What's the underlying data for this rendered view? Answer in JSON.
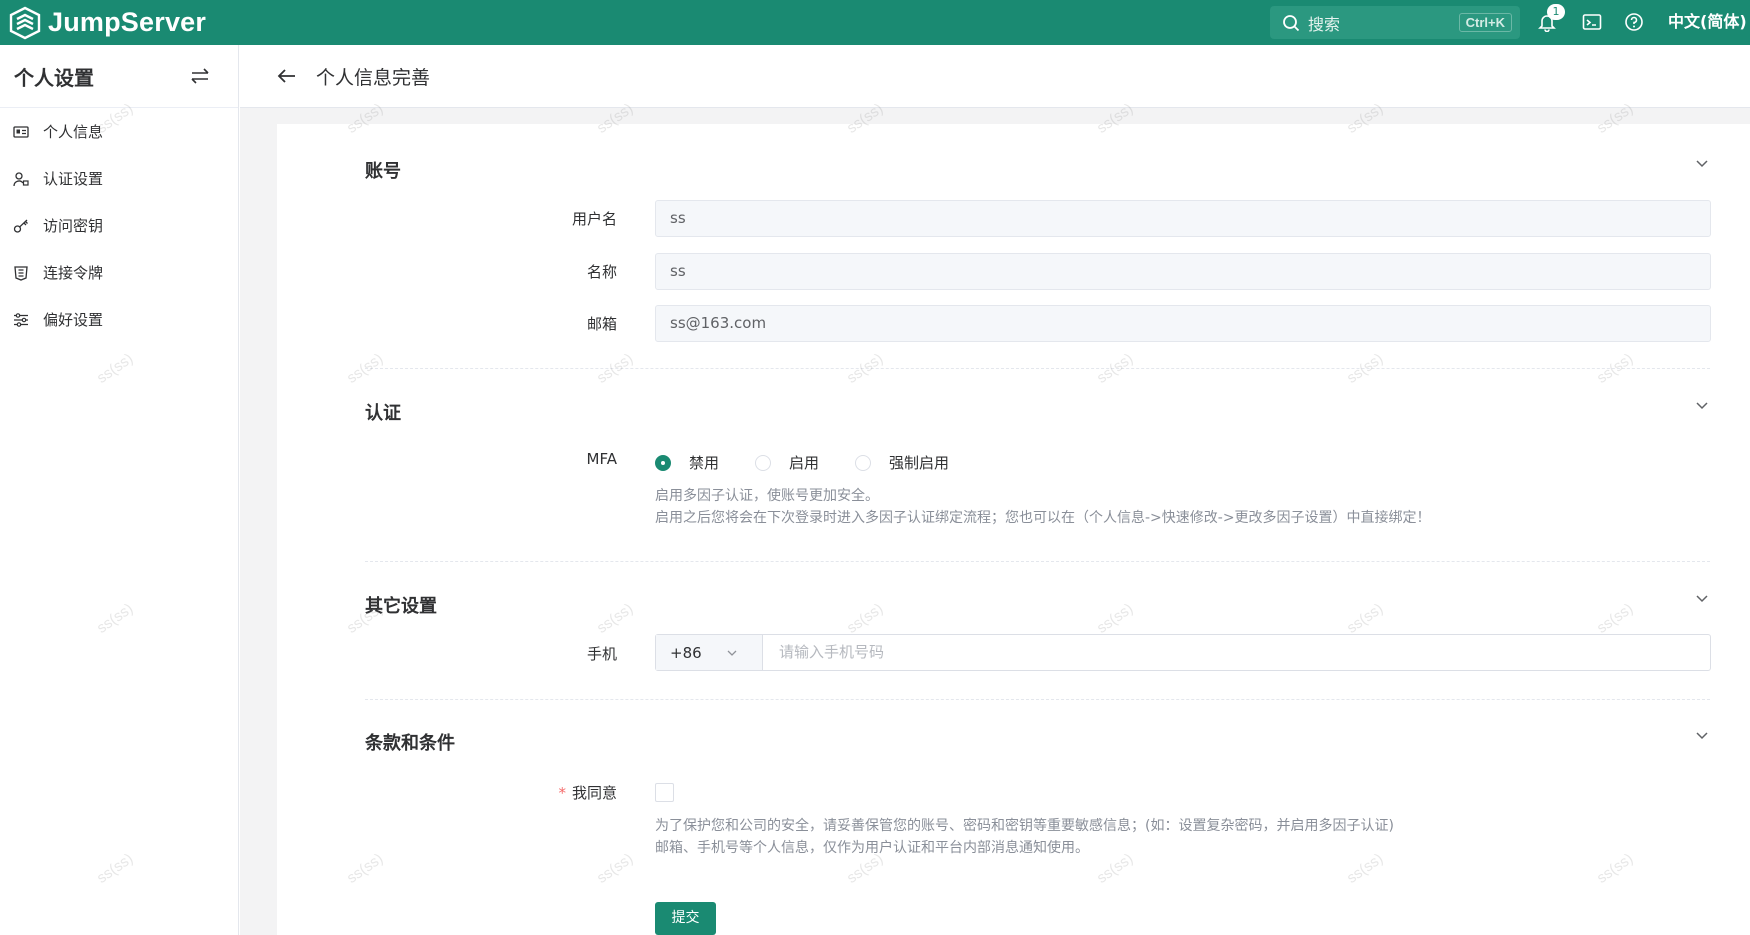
{
  "app": {
    "name": "JumpServer"
  },
  "topbar": {
    "search_label": "搜索",
    "search_shortcut": "Ctrl+K",
    "notification_count": "1",
    "language": "中文(简体)"
  },
  "sidebar": {
    "title": "个人设置",
    "items": [
      {
        "label": "个人信息",
        "icon": "id-card-icon"
      },
      {
        "label": "认证设置",
        "icon": "user-lock-icon"
      },
      {
        "label": "访问密钥",
        "icon": "key-icon"
      },
      {
        "label": "连接令牌",
        "icon": "token-icon"
      },
      {
        "label": "偏好设置",
        "icon": "sliders-icon"
      }
    ]
  },
  "page": {
    "title": "个人信息完善"
  },
  "sections": {
    "account": {
      "title": "账号",
      "username_label": "用户名",
      "username_value": "ss",
      "name_label": "名称",
      "name_value": "ss",
      "email_label": "邮箱",
      "email_value": "ss@163.com"
    },
    "auth": {
      "title": "认证",
      "mfa_label": "MFA",
      "options": [
        "禁用",
        "启用",
        "强制启用"
      ],
      "selected": "禁用",
      "help_line1": "启用多因子认证，使账号更加安全。",
      "help_line2": "启用之后您将会在下次登录时进入多因子认证绑定流程；您也可以在（个人信息->快速修改->更改多因子设置）中直接绑定！"
    },
    "other": {
      "title": "其它设置",
      "phone_label": "手机",
      "phone_code": "+86",
      "phone_placeholder": "请输入手机号码"
    },
    "terms": {
      "title": "条款和条件",
      "required_mark": "*",
      "agree_label": "我同意",
      "help_line1": "为了保护您和公司的安全，请妥善保管您的账号、密码和密钥等重要敏感信息；(如：设置复杂密码，并启用多因子认证)",
      "help_line2": "邮箱、手机号等个人信息，仅作为用户认证和平台内部消息通知使用。"
    }
  },
  "submit_label": "提交",
  "watermark": "ss(ss)",
  "colors": {
    "brand": "#1a8a72",
    "background": "#f3f3f4"
  }
}
